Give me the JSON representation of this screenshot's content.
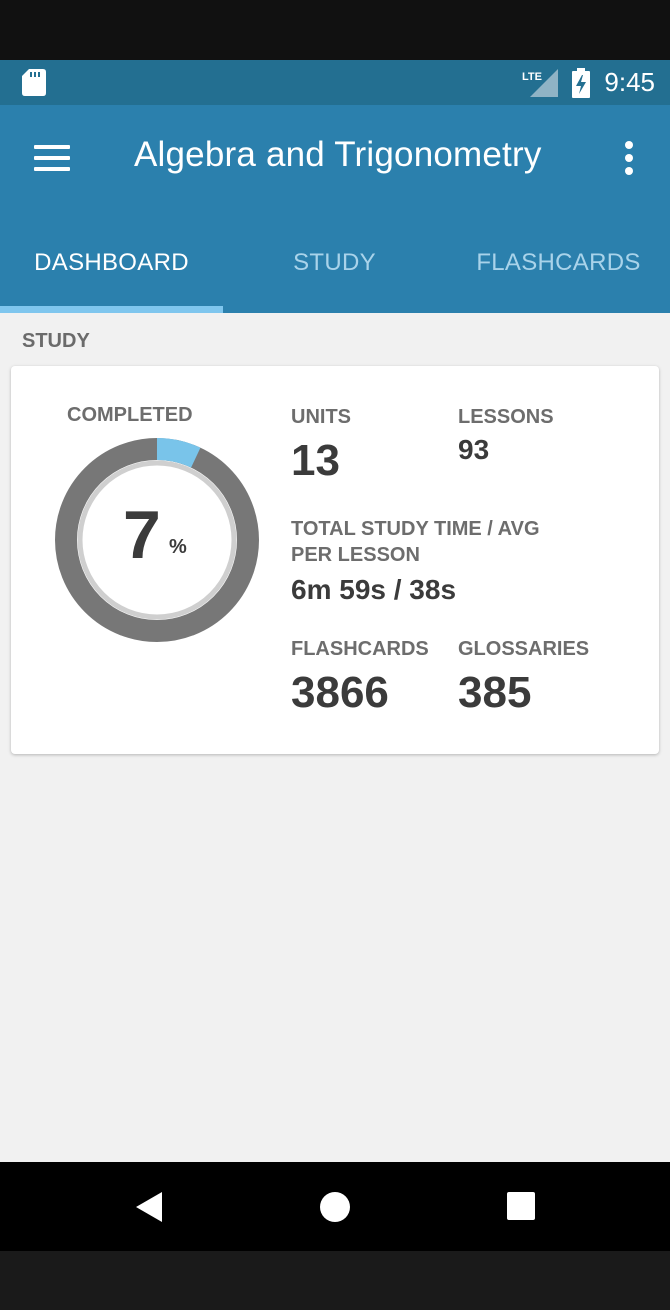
{
  "status_bar": {
    "network_label": "LTE",
    "time": "9:45"
  },
  "app_bar": {
    "title": "Algebra and Trigonometry"
  },
  "tabs": [
    {
      "label": "DASHBOARD",
      "active": true
    },
    {
      "label": "STUDY",
      "active": false
    },
    {
      "label": "FLASHCARDS",
      "active": false
    }
  ],
  "study_section": {
    "label": "STUDY",
    "completed_label": "COMPLETED",
    "completed_percent": "7",
    "percent_sign": "%",
    "units_label": "UNITS",
    "units_value": "13",
    "lessons_label": "LESSONS",
    "lessons_value": "93",
    "study_time_label_line1": "TOTAL STUDY TIME / AVG",
    "study_time_label_line2": "PER LESSON",
    "study_time_value": "6m 59s / 38s",
    "flashcards_label": "FLASHCARDS",
    "flashcards_value": "3866",
    "glossaries_label": "GLOSSARIES",
    "glossaries_value": "385"
  },
  "colors": {
    "status_bar": "#236f91",
    "app_bar": "#2b80ad",
    "tab_indicator": "#7fc6ee",
    "donut_track": "#777777",
    "donut_progress": "#79c4ea"
  }
}
